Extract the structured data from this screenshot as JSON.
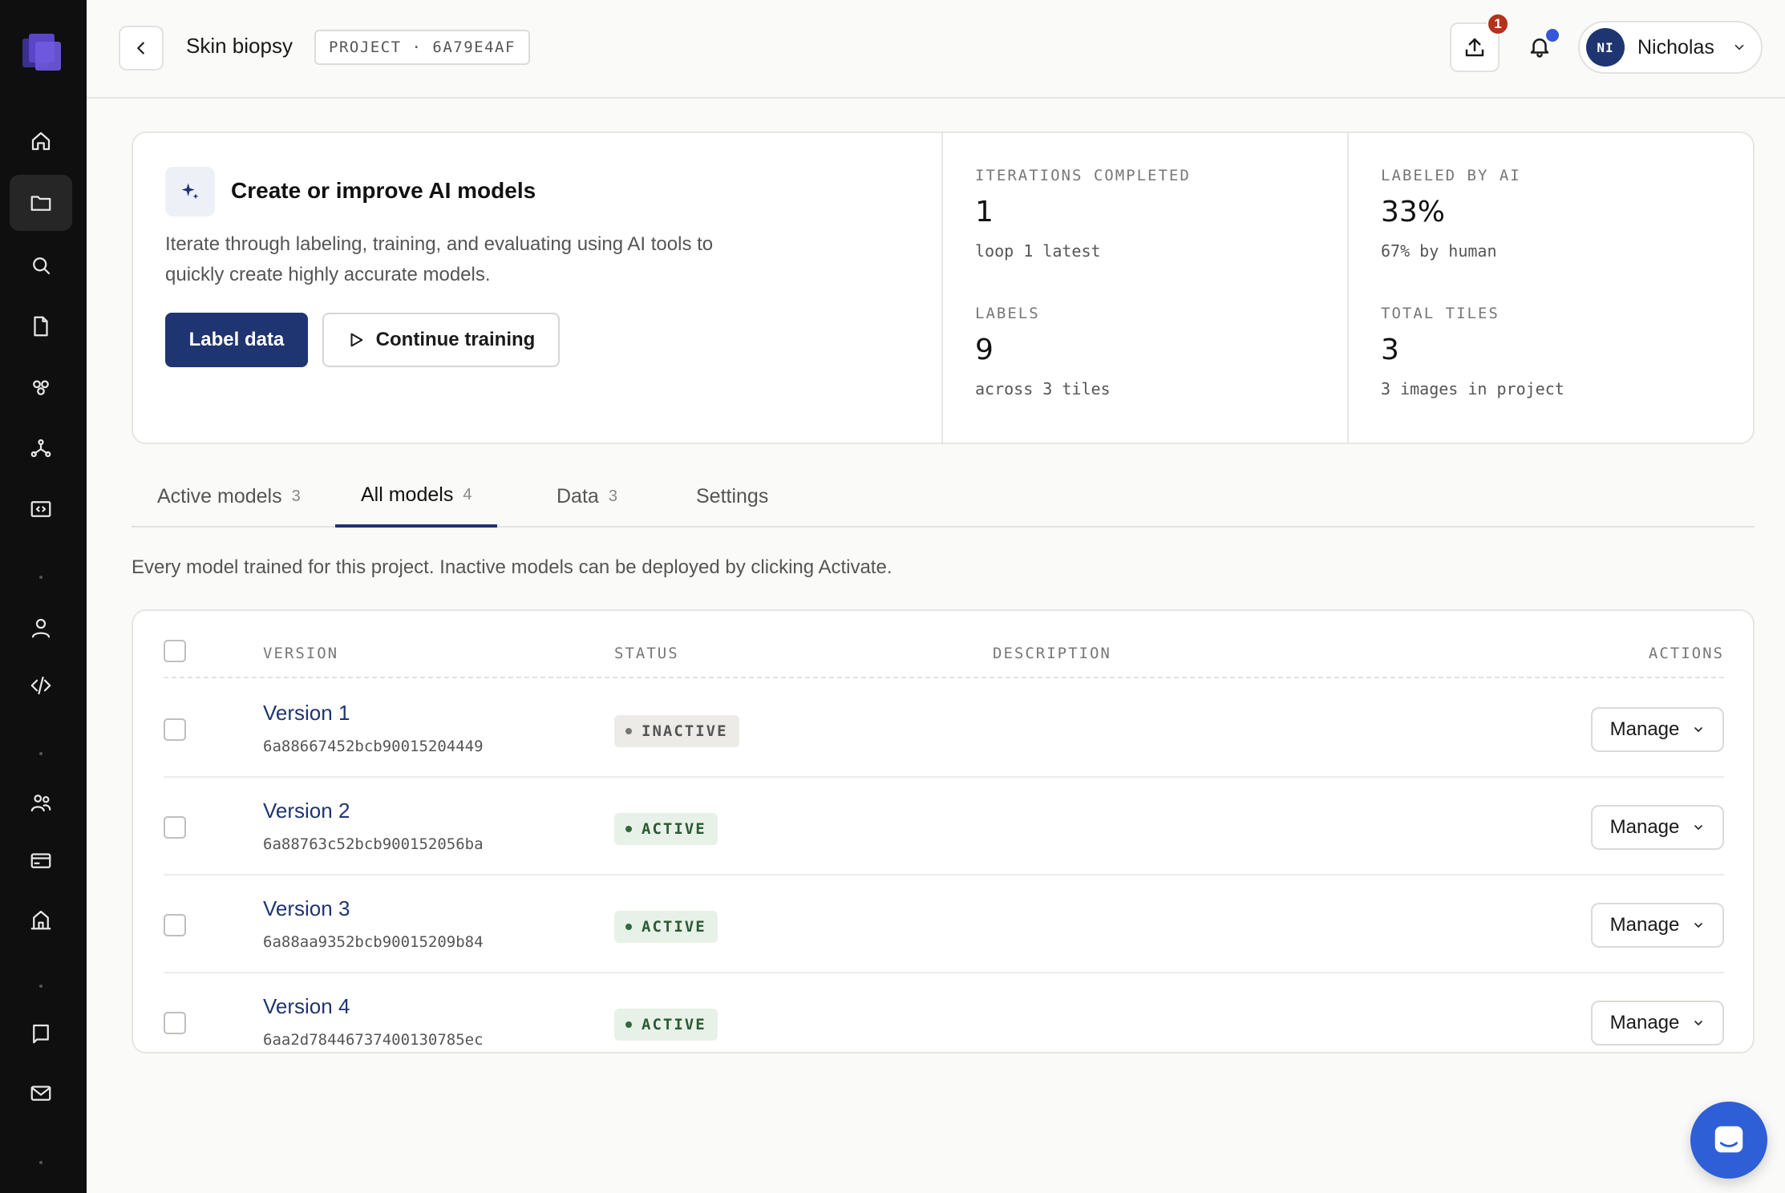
{
  "header": {
    "title": "Skin biopsy",
    "project_tag": "PROJECT · 6A79E4AF",
    "upload_badge": "1",
    "user_initials": "NI",
    "user_name": "Nicholas"
  },
  "hero": {
    "title": "Create or improve AI models",
    "description": "Iterate through labeling, training, and evaluating using AI tools to quickly create highly accurate models.",
    "primary_button": "Label data",
    "secondary_button": "Continue training",
    "stats": [
      {
        "label": "ITERATIONS COMPLETED",
        "value": "1",
        "sub": "loop 1 latest"
      },
      {
        "label": "LABELS",
        "value": "9",
        "sub": "across 3 tiles"
      },
      {
        "label": "LABELED BY AI",
        "value": "33%",
        "sub": "67% by human"
      },
      {
        "label": "TOTAL TILES",
        "value": "3",
        "sub": "3 images in project"
      }
    ]
  },
  "tabs": [
    {
      "label": "Active models",
      "count": "3"
    },
    {
      "label": "All models",
      "count": "4"
    },
    {
      "label": "Data",
      "count": "3"
    },
    {
      "label": "Settings",
      "count": ""
    }
  ],
  "intro": "Every model trained for this project. Inactive models can be deployed by clicking Activate.",
  "table": {
    "headers": {
      "version": "VERSION",
      "status": "STATUS",
      "description": "DESCRIPTION",
      "actions": "ACTIONS"
    },
    "manage_label": "Manage",
    "rows": [
      {
        "name": "Version 1",
        "id": "6a88667452bcb90015204449",
        "status": "INACTIVE"
      },
      {
        "name": "Version 2",
        "id": "6a88763c52bcb900152056ba",
        "status": "ACTIVE"
      },
      {
        "name": "Version 3",
        "id": "6a88aa9352bcb90015209b84",
        "status": "ACTIVE"
      },
      {
        "name": "Version 4",
        "id": "6aa2d78446737400130785ec",
        "status": "ACTIVE"
      }
    ]
  },
  "icons": {
    "sidebar": [
      "home-icon",
      "folder-icon",
      "search-icon",
      "document-icon",
      "nodes-icon",
      "network-icon",
      "code-window-icon",
      "user-icon",
      "code-icon",
      "team-icon",
      "credit-card-icon",
      "building-icon",
      "book-icon",
      "mail-icon"
    ]
  },
  "colors": {
    "accent": "#1e3572",
    "active_green": "#2a5a34",
    "badge_red": "#b3321c",
    "chat_blue": "#2f5fd6"
  }
}
